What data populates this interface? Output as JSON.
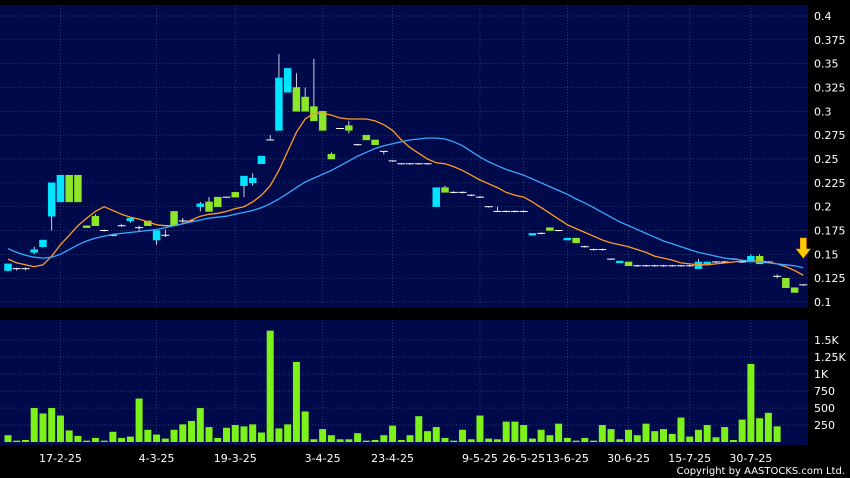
{
  "chart_data": {
    "type": "candlestick",
    "colors": {
      "up": "#00e5ff",
      "down": "#8ee62a",
      "ma_short": "#ff9a28",
      "ma_long": "#3aa6ff",
      "volume": "#7cf21a",
      "plot_bg": "#000a4a",
      "arrow": "#ffcc00"
    },
    "price_axis": {
      "ylim": [
        0.1,
        0.4
      ],
      "ticks": [
        "0.4",
        "0.375",
        "0.35",
        "0.325",
        "0.3",
        "0.275",
        "0.25",
        "0.225",
        "0.2",
        "0.175",
        "0.15",
        "0.125",
        "0.1"
      ]
    },
    "volume_axis": {
      "ylim": [
        0,
        1650
      ],
      "ticks": [
        "1.5K",
        "1.25K",
        "1K",
        "750",
        "500",
        "250"
      ]
    },
    "x_labels": [
      {
        "label": "17-2-25",
        "bar": 6
      },
      {
        "label": "4-3-25",
        "bar": 17
      },
      {
        "label": "19-3-25",
        "bar": 26
      },
      {
        "label": "3-4-25",
        "bar": 36
      },
      {
        "label": "23-4-25",
        "bar": 44
      },
      {
        "label": "9-5-25",
        "bar": 54
      },
      {
        "label": "26-5-25",
        "bar": 59
      },
      {
        "label": "13-6-25",
        "bar": 64
      },
      {
        "label": "30-6-25",
        "bar": 71
      },
      {
        "label": "15-7-25",
        "bar": 78
      },
      {
        "label": "30-7-25",
        "bar": 85
      }
    ],
    "candles": [
      [
        0.133,
        0.14,
        0.132,
        0.14
      ],
      [
        0.135,
        0.136,
        0.133,
        0.135
      ],
      [
        0.135,
        0.136,
        0.133,
        0.134
      ],
      [
        0.152,
        0.158,
        0.15,
        0.155
      ],
      [
        0.158,
        0.165,
        0.157,
        0.165
      ],
      [
        0.19,
        0.225,
        0.175,
        0.225
      ],
      [
        0.205,
        0.233,
        0.205,
        0.233
      ],
      [
        0.233,
        0.233,
        0.205,
        0.205
      ],
      [
        0.233,
        0.233,
        0.205,
        0.205
      ],
      [
        0.18,
        0.178,
        0.18,
        0.178
      ],
      [
        0.19,
        0.192,
        0.18,
        0.18
      ],
      [
        0.175,
        0.176,
        0.174,
        0.175
      ],
      [
        0.17,
        0.171,
        0.169,
        0.17
      ],
      [
        0.18,
        0.182,
        0.179,
        0.18
      ],
      [
        0.185,
        0.188,
        0.183,
        0.188
      ],
      [
        0.178,
        0.18,
        0.175,
        0.178
      ],
      [
        0.185,
        0.185,
        0.18,
        0.18
      ],
      [
        0.165,
        0.175,
        0.16,
        0.175
      ],
      [
        0.17,
        0.176,
        0.168,
        0.17
      ],
      [
        0.195,
        0.195,
        0.18,
        0.18
      ],
      [
        0.185,
        0.188,
        0.183,
        0.185
      ],
      [
        0.185,
        0.186,
        0.184,
        0.185
      ],
      [
        0.2,
        0.205,
        0.195,
        0.203
      ],
      [
        0.205,
        0.21,
        0.195,
        0.195
      ],
      [
        0.21,
        0.21,
        0.2,
        0.2
      ],
      [
        0.21,
        0.21,
        0.209,
        0.21
      ],
      [
        0.215,
        0.215,
        0.21,
        0.21
      ],
      [
        0.222,
        0.232,
        0.21,
        0.232
      ],
      [
        0.225,
        0.235,
        0.222,
        0.23
      ],
      [
        0.245,
        0.253,
        0.245,
        0.253
      ],
      [
        0.27,
        0.275,
        0.27,
        0.27
      ],
      [
        0.28,
        0.36,
        0.28,
        0.335
      ],
      [
        0.32,
        0.345,
        0.32,
        0.345
      ],
      [
        0.325,
        0.34,
        0.3,
        0.3
      ],
      [
        0.315,
        0.325,
        0.31,
        0.3
      ],
      [
        0.305,
        0.355,
        0.29,
        0.29
      ],
      [
        0.3,
        0.3,
        0.28,
        0.28
      ],
      [
        0.255,
        0.257,
        0.25,
        0.25
      ],
      [
        0.282,
        0.282,
        0.282,
        0.282
      ],
      [
        0.285,
        0.29,
        0.277,
        0.28
      ],
      [
        0.265,
        0.266,
        0.264,
        0.265
      ],
      [
        0.275,
        0.275,
        0.27,
        0.27
      ],
      [
        0.27,
        0.27,
        0.265,
        0.265
      ],
      [
        0.258,
        0.258,
        0.255,
        0.258
      ],
      [
        0.248,
        0.248,
        0.247,
        0.248
      ],
      [
        0.245,
        0.245,
        0.244,
        0.245
      ],
      [
        0.245,
        0.245,
        0.244,
        0.245
      ],
      [
        0.245,
        0.245,
        0.244,
        0.245
      ],
      [
        0.245,
        0.245,
        0.244,
        0.245
      ],
      [
        0.2,
        0.22,
        0.2,
        0.22
      ],
      [
        0.22,
        0.222,
        0.215,
        0.215
      ],
      [
        0.215,
        0.216,
        0.214,
        0.215
      ],
      [
        0.215,
        0.216,
        0.214,
        0.215
      ],
      [
        0.212,
        0.213,
        0.211,
        0.212
      ],
      [
        0.21,
        0.211,
        0.209,
        0.21
      ],
      [
        0.2,
        0.2,
        0.199,
        0.2
      ],
      [
        0.195,
        0.2,
        0.195,
        0.195
      ],
      [
        0.195,
        0.196,
        0.194,
        0.195
      ],
      [
        0.195,
        0.196,
        0.194,
        0.195
      ],
      [
        0.195,
        0.196,
        0.194,
        0.195
      ],
      [
        0.17,
        0.172,
        0.17,
        0.172
      ],
      [
        0.172,
        0.173,
        0.171,
        0.172
      ],
      [
        0.178,
        0.178,
        0.175,
        0.175
      ],
      [
        0.175,
        0.175,
        0.174,
        0.175
      ],
      [
        0.165,
        0.167,
        0.165,
        0.167
      ],
      [
        0.167,
        0.167,
        0.162,
        0.162
      ],
      [
        0.158,
        0.159,
        0.157,
        0.158
      ],
      [
        0.155,
        0.156,
        0.154,
        0.155
      ],
      [
        0.155,
        0.156,
        0.154,
        0.155
      ],
      [
        0.145,
        0.145,
        0.144,
        0.145
      ],
      [
        0.141,
        0.143,
        0.141,
        0.143
      ],
      [
        0.142,
        0.142,
        0.138,
        0.138
      ],
      [
        0.138,
        0.139,
        0.137,
        0.138
      ],
      [
        0.138,
        0.139,
        0.137,
        0.138
      ],
      [
        0.138,
        0.139,
        0.137,
        0.138
      ],
      [
        0.138,
        0.139,
        0.137,
        0.138
      ],
      [
        0.138,
        0.139,
        0.137,
        0.138
      ],
      [
        0.138,
        0.139,
        0.137,
        0.138
      ],
      [
        0.138,
        0.139,
        0.137,
        0.138
      ],
      [
        0.135,
        0.145,
        0.135,
        0.142
      ],
      [
        0.14,
        0.142,
        0.14,
        0.142
      ],
      [
        0.142,
        0.143,
        0.141,
        0.142
      ],
      [
        0.142,
        0.143,
        0.141,
        0.142
      ],
      [
        0.145,
        0.146,
        0.144,
        0.145
      ],
      [
        0.142,
        0.143,
        0.141,
        0.142
      ],
      [
        0.142,
        0.15,
        0.142,
        0.148
      ],
      [
        0.148,
        0.15,
        0.14,
        0.14
      ],
      [
        0.142,
        0.143,
        0.141,
        0.142
      ],
      [
        0.127,
        0.129,
        0.125,
        0.127
      ],
      [
        0.125,
        0.125,
        0.115,
        0.115
      ],
      [
        0.115,
        0.115,
        0.11,
        0.11
      ],
      [
        0.118,
        0.118,
        0.117,
        0.118
      ]
    ],
    "ma_short": [
      0.145,
      0.141,
      0.139,
      0.137,
      0.139,
      0.148,
      0.16,
      0.17,
      0.18,
      0.188,
      0.195,
      0.2,
      0.196,
      0.192,
      0.189,
      0.187,
      0.184,
      0.181,
      0.18,
      0.18,
      0.182,
      0.186,
      0.19,
      0.192,
      0.193,
      0.195,
      0.198,
      0.2,
      0.205,
      0.212,
      0.222,
      0.238,
      0.258,
      0.278,
      0.292,
      0.298,
      0.298,
      0.296,
      0.293,
      0.292,
      0.292,
      0.292,
      0.29,
      0.286,
      0.28,
      0.27,
      0.262,
      0.256,
      0.25,
      0.246,
      0.245,
      0.242,
      0.238,
      0.233,
      0.228,
      0.224,
      0.22,
      0.215,
      0.212,
      0.21,
      0.205,
      0.199,
      0.193,
      0.187,
      0.181,
      0.177,
      0.173,
      0.169,
      0.165,
      0.162,
      0.16,
      0.158,
      0.155,
      0.152,
      0.148,
      0.146,
      0.144,
      0.141,
      0.14,
      0.139,
      0.139,
      0.14,
      0.141,
      0.142,
      0.143,
      0.143,
      0.143,
      0.142,
      0.14,
      0.137,
      0.133,
      0.128
    ],
    "ma_long": [
      0.156,
      0.152,
      0.149,
      0.147,
      0.146,
      0.147,
      0.15,
      0.155,
      0.16,
      0.164,
      0.167,
      0.169,
      0.171,
      0.172,
      0.173,
      0.174,
      0.175,
      0.176,
      0.178,
      0.18,
      0.182,
      0.184,
      0.186,
      0.188,
      0.189,
      0.19,
      0.192,
      0.194,
      0.196,
      0.199,
      0.203,
      0.208,
      0.214,
      0.22,
      0.226,
      0.23,
      0.234,
      0.238,
      0.243,
      0.248,
      0.253,
      0.257,
      0.261,
      0.264,
      0.266,
      0.268,
      0.27,
      0.271,
      0.272,
      0.272,
      0.271,
      0.268,
      0.264,
      0.258,
      0.252,
      0.247,
      0.243,
      0.239,
      0.236,
      0.233,
      0.229,
      0.225,
      0.221,
      0.217,
      0.213,
      0.208,
      0.204,
      0.199,
      0.194,
      0.189,
      0.184,
      0.18,
      0.176,
      0.172,
      0.168,
      0.164,
      0.161,
      0.158,
      0.155,
      0.152,
      0.15,
      0.148,
      0.146,
      0.145,
      0.144,
      0.143,
      0.142,
      0.141,
      0.14,
      0.139,
      0.138,
      0.136
    ],
    "volumes": [
      100,
      20,
      30,
      500,
      420,
      500,
      390,
      170,
      90,
      20,
      60,
      20,
      150,
      60,
      80,
      640,
      180,
      110,
      50,
      180,
      260,
      310,
      500,
      220,
      60,
      210,
      250,
      230,
      260,
      140,
      1640,
      200,
      260,
      1180,
      450,
      40,
      190,
      100,
      40,
      40,
      130,
      20,
      30,
      100,
      240,
      30,
      100,
      380,
      160,
      220,
      60,
      20,
      180,
      40,
      390,
      50,
      40,
      300,
      300,
      250,
      50,
      180,
      100,
      270,
      60,
      20,
      60,
      20,
      250,
      190,
      40,
      180,
      100,
      270,
      160,
      190,
      120,
      360,
      80,
      180,
      250,
      70,
      220,
      30,
      330,
      1150,
      350,
      430,
      230
    ],
    "arrow_bar": 91,
    "copyright": "Copyright by AASTOCKS.com Ltd."
  }
}
